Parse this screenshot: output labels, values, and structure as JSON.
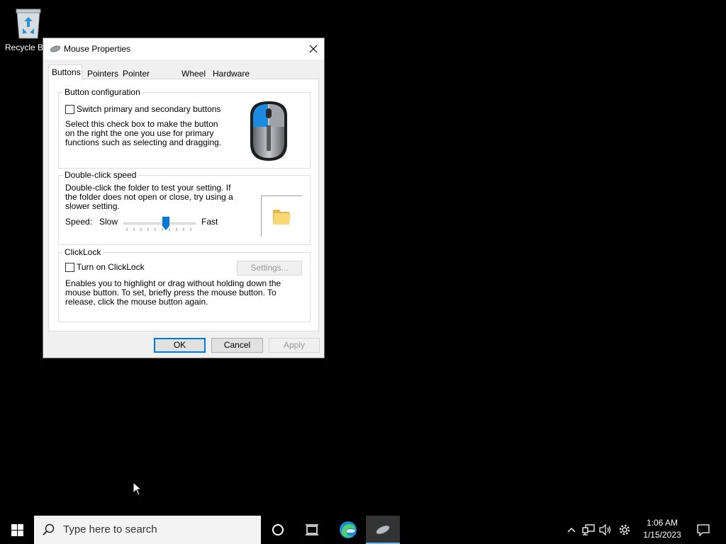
{
  "desktop": {
    "recycle_bin_label": "Recycle Bin"
  },
  "dialog": {
    "title": "Mouse Properties",
    "tabs": [
      {
        "label": "Buttons",
        "active": true
      },
      {
        "label": "Pointers",
        "active": false
      },
      {
        "label": "Pointer Options",
        "active": false
      },
      {
        "label": "Wheel",
        "active": false
      },
      {
        "label": "Hardware",
        "active": false
      }
    ],
    "button_configuration": {
      "title": "Button configuration",
      "checkbox_label": "Switch primary and secondary buttons",
      "checked": false,
      "description": "Select this check box to make the button on the right the one you use for primary functions such as selecting and dragging."
    },
    "double_click_speed": {
      "title": "Double-click speed",
      "description": "Double-click the folder to test your setting. If the folder does not open or close, try using a slower setting.",
      "speed_label": "Speed:",
      "slow_label": "Slow",
      "fast_label": "Fast",
      "slider_value": 0.6
    },
    "clicklock": {
      "title": "ClickLock",
      "checkbox_label": "Turn on ClickLock",
      "checked": false,
      "settings_button": "Settings...",
      "description": "Enables you to highlight or drag without holding down the mouse button. To set, briefly press the mouse button. To release, click the mouse button again."
    },
    "buttons": {
      "ok": "OK",
      "cancel": "Cancel",
      "apply": "Apply"
    }
  },
  "taskbar": {
    "search_placeholder": "Type here to search",
    "time": "1:06 AM",
    "date": "1/15/2023",
    "accent_color": "#6cb8f6"
  },
  "colors": {
    "accent": "#0078d7",
    "desktop_background": "#000000"
  }
}
